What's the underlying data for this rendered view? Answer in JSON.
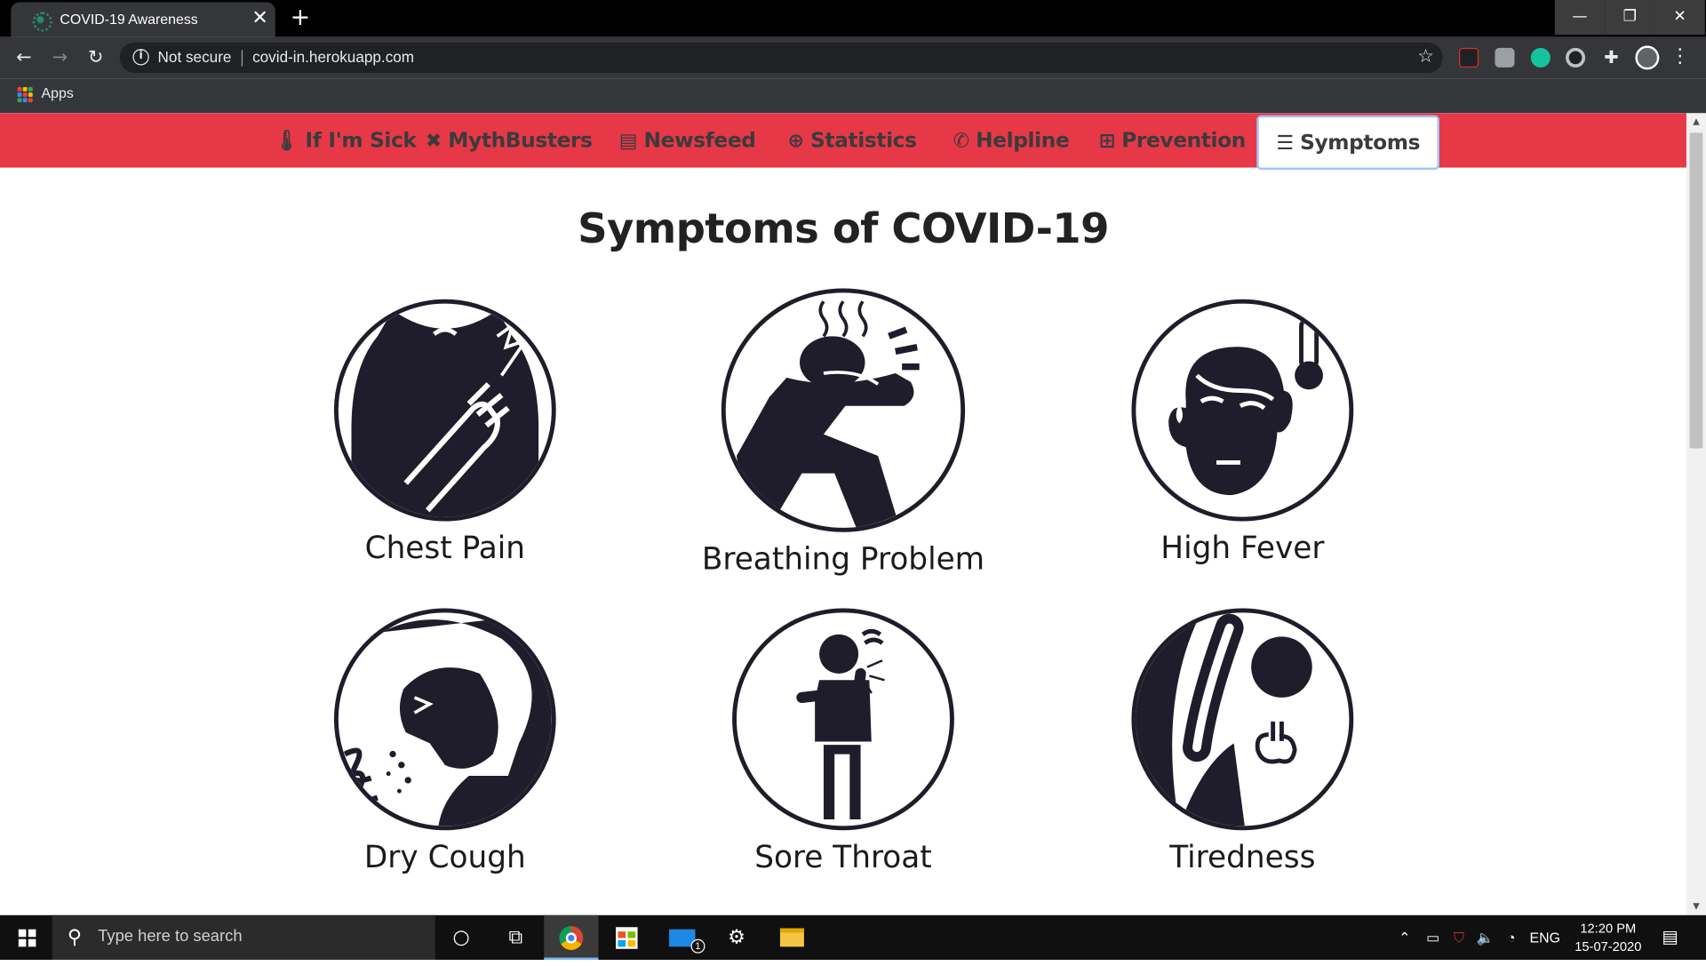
{
  "browser": {
    "tab_title": "COVID-19 Awareness",
    "tab_close": "✕",
    "new_tab": "+",
    "window_min": "—",
    "window_max": "❐",
    "window_close": "✕",
    "security_label": "Not secure",
    "url": "covid-in.herokuapp.com",
    "bookmarks": {
      "apps_label": "Apps"
    }
  },
  "site": {
    "nav": [
      {
        "label": "If I'm Sick",
        "icon": "thermometer-icon"
      },
      {
        "label": "MythBusters",
        "icon": "x-icon"
      },
      {
        "label": "Newsfeed",
        "icon": "newspaper-icon"
      },
      {
        "label": "Statistics",
        "icon": "globe-icon"
      },
      {
        "label": "Helpline",
        "icon": "phone-icon"
      },
      {
        "label": "Prevention",
        "icon": "medkit-icon"
      },
      {
        "label": "Symptoms",
        "icon": "list-icon",
        "active": true
      }
    ],
    "heading": "Symptoms of COVID-19",
    "symptoms": [
      {
        "label": "Chest Pain",
        "icon": "chest-pain-icon"
      },
      {
        "label": "Breathing Problem",
        "icon": "breathing-problem-icon"
      },
      {
        "label": "High Fever",
        "icon": "high-fever-icon"
      },
      {
        "label": "Dry Cough",
        "icon": "dry-cough-icon"
      },
      {
        "label": "Sore Throat",
        "icon": "sore-throat-icon"
      },
      {
        "label": "Tiredness",
        "icon": "tiredness-icon"
      }
    ]
  },
  "colors": {
    "nav_bg": "#e73848",
    "nav_text": "#3b3b3b",
    "active_border": "#9fc3ff",
    "icon_ink": "#1f1d2b"
  },
  "taskbar": {
    "search_placeholder": "Type here to search",
    "mail_badge": "1",
    "language": "ENG",
    "time": "12:20 PM",
    "date": "15-07-2020"
  }
}
